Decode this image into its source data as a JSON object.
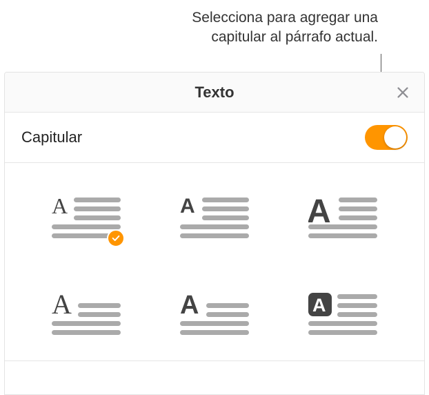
{
  "callout": {
    "line1": "Selecciona para agregar una",
    "line2": "capitular al párrafo actual."
  },
  "panel": {
    "title": "Texto"
  },
  "row": {
    "label": "Capitular",
    "toggle_on": true
  },
  "options": [
    {
      "id": "dropcap-style-1",
      "selected": true
    },
    {
      "id": "dropcap-style-2",
      "selected": false
    },
    {
      "id": "dropcap-style-3",
      "selected": false
    },
    {
      "id": "dropcap-style-4",
      "selected": false
    },
    {
      "id": "dropcap-style-5",
      "selected": false
    },
    {
      "id": "dropcap-style-6",
      "selected": false
    }
  ],
  "colors": {
    "accent": "#ff9500",
    "icon_gray": "#aaa",
    "icon_dark": "#444"
  }
}
